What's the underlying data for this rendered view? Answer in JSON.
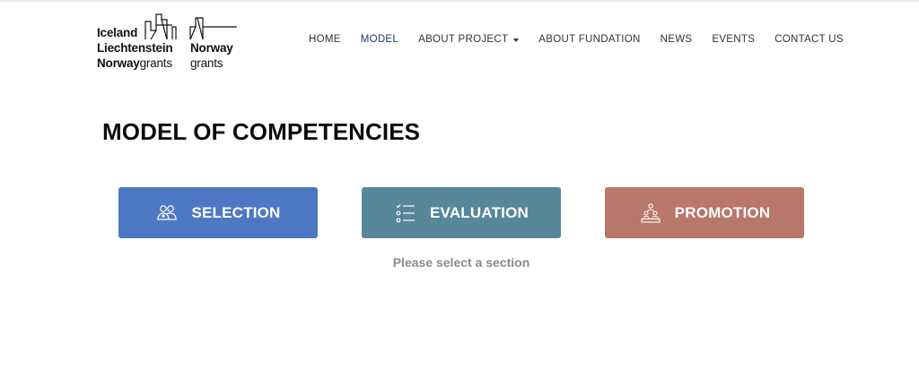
{
  "logo": {
    "left_lines": [
      {
        "text": "Iceland",
        "weight": "bold"
      },
      {
        "text": "Liechtenstein",
        "weight": "bold"
      },
      {
        "bold": "Norway",
        "light": "grants"
      }
    ],
    "right_lines": [
      {
        "text": "Norway",
        "weight": "bold"
      },
      {
        "text": "grants",
        "weight": "light"
      }
    ]
  },
  "nav": {
    "items": [
      {
        "label": "HOME"
      },
      {
        "label": "MODEL",
        "active": true
      },
      {
        "label": "ABOUT PROJECT",
        "dropdown": true
      },
      {
        "label": "ABOUT FUNDATION"
      },
      {
        "label": "NEWS"
      },
      {
        "label": "EVENTS"
      },
      {
        "label": "CONTACT US"
      }
    ]
  },
  "main": {
    "title": "MODEL OF COMPETENCIES",
    "sections": [
      {
        "label": "SELECTION",
        "icon": "people-group-icon",
        "color": "#4f78c4"
      },
      {
        "label": "EVALUATION",
        "icon": "checklist-icon",
        "color": "#58879b"
      },
      {
        "label": "PROMOTION",
        "icon": "team-pyramid-icon",
        "color": "#b87769"
      }
    ],
    "hint": "Please select a section"
  }
}
